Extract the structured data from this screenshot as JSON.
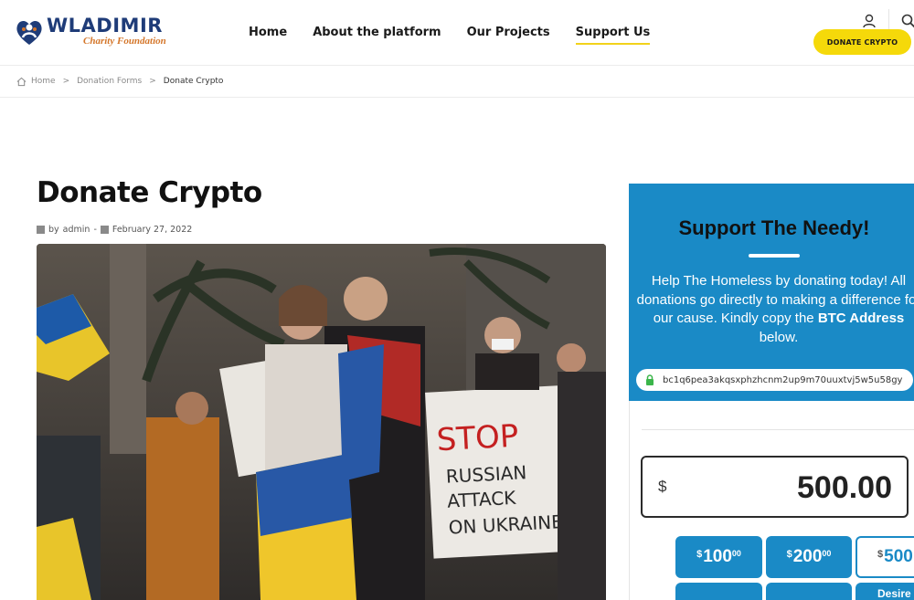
{
  "header": {
    "logo": {
      "title": "WLADIMIR",
      "subtitle": "Charity Foundation"
    },
    "nav": [
      {
        "label": "Home"
      },
      {
        "label": "About the platform"
      },
      {
        "label": "Our Projects"
      },
      {
        "label": "Support Us",
        "active": true
      }
    ],
    "cta_label": "DONATE CRYPTO",
    "icons": [
      "user-icon",
      "search-icon"
    ]
  },
  "breadcrumb": [
    {
      "label": "Home"
    },
    {
      "label": "Donation Forms"
    },
    {
      "label": "Donate Crypto"
    }
  ],
  "breadcrumb_separator": ">",
  "post": {
    "title": "Donate Crypto",
    "by": "by",
    "author": "admin",
    "date_sep": "-",
    "date": "February 27, 2022",
    "image_sign": [
      "STOP",
      "RUSSIAN",
      "ATTACK",
      "ON UKRAINE"
    ]
  },
  "sidebar": {
    "heading": "Support The Needy!",
    "body_before": "Help The Homeless by donating today! All donations go directly to making a difference for our cause. Kindly copy the ",
    "body_bold": "BTC Address",
    "body_after": " below.",
    "btc_address": "bc1q6pea3akqsxphzhcnm2up9m70uuxtvj5w5u58gy",
    "currency_symbol": "$",
    "amount": "500.00",
    "levels": [
      {
        "symbol": "$",
        "amount": "100",
        "cents": "00"
      },
      {
        "symbol": "$",
        "amount": "200",
        "cents": "00"
      },
      {
        "symbol": "$",
        "amount": "500",
        "cents": ""
      },
      {
        "label": "Desire"
      }
    ]
  },
  "colors": {
    "accent_yellow": "#f5d90a",
    "panel_blue": "#1a8ac6",
    "logo_navy": "#1f3c78",
    "logo_orange": "#d4762a"
  }
}
